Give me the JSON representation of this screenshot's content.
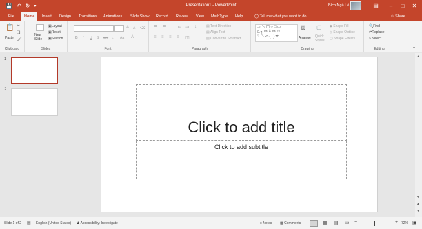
{
  "titlebar": {
    "title": "Presentation1 - PowerPoint",
    "user": "Bích Ngà Lê",
    "save_icon": "save-icon",
    "undo_icon": "undo-icon",
    "redo_icon": "redo-icon",
    "colors": {
      "bar": "#c4452b",
      "text": "#ffffff"
    }
  },
  "tabs": {
    "items": [
      "File",
      "Home",
      "Insert",
      "Design",
      "Transitions",
      "Animations",
      "Slide Show",
      "Record",
      "Review",
      "View",
      "MathType",
      "Help"
    ],
    "active": "Home",
    "tell_me": "Tell me what you want to do",
    "share": "Share"
  },
  "ribbon": {
    "clipboard": {
      "label": "Clipboard",
      "paste": "Paste"
    },
    "slides": {
      "label": "Slides",
      "new_slide": "New",
      "new_slide_2": "Slide",
      "layout": "Layout",
      "reset": "Reset",
      "section": "Section"
    },
    "font": {
      "label": "Font",
      "font_size_up": "A",
      "font_size_down": "A",
      "case": "Aa"
    },
    "paragraph": {
      "label": "Paragraph",
      "text_direction": "Text Direction",
      "align_text": "Align Text",
      "smartart": "Convert to SmartArt"
    },
    "drawing": {
      "label": "Drawing",
      "arrange": "Arrange",
      "quick_styles": "Quick",
      "quick_styles_2": "Styles",
      "shape_fill": "Shape Fill",
      "shape_outline": "Shape Outline",
      "shape_effects": "Shape Effects"
    },
    "editing": {
      "label": "Editing",
      "find": "Find",
      "replace": "Replace",
      "select": "Select"
    }
  },
  "thumbnails": [
    {
      "number": "1",
      "selected": true
    },
    {
      "number": "2",
      "selected": false
    }
  ],
  "slide": {
    "title_placeholder": "Click to add title",
    "subtitle_placeholder": "Click to add subtitle"
  },
  "statusbar": {
    "slide_count": "Slide 1 of 2",
    "language": "English (United States)",
    "accessibility": "Accessibility: Investigate",
    "notes": "Notes",
    "comments": "Comments",
    "zoom": "72%"
  }
}
